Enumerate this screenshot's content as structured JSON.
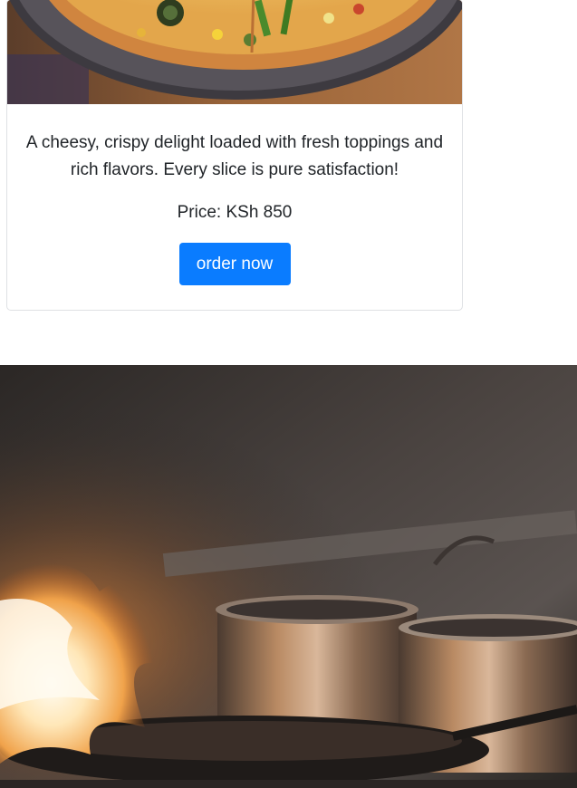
{
  "card": {
    "image_alt": "pizza",
    "description": "A cheesy, crispy delight loaded with fresh toppings and rich flavors. Every slice is pure satisfaction!",
    "price": "Price: KSh 850",
    "button_label": "order now"
  },
  "hero": {
    "image_alt": "kitchen-flame"
  },
  "colors": {
    "button": "#0a7cff",
    "button_text": "#ffffff",
    "card_border": "#dfe1e4",
    "text": "#212529"
  }
}
